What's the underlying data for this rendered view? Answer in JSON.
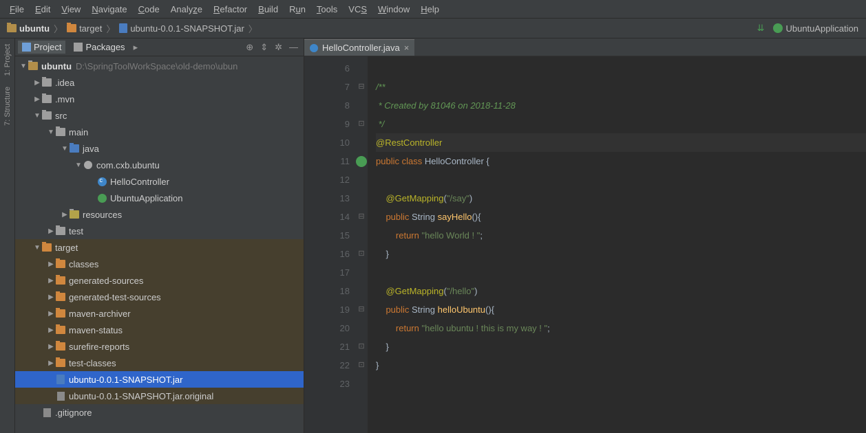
{
  "menu": [
    "File",
    "Edit",
    "View",
    "Navigate",
    "Code",
    "Analyze",
    "Refactor",
    "Build",
    "Run",
    "Tools",
    "VCS",
    "Window",
    "Help"
  ],
  "breadcrumb": {
    "items": [
      "ubuntu",
      "target",
      "ubuntu-0.0.1-SNAPSHOT.jar"
    ]
  },
  "runconfig": {
    "label": "UbuntuApplication"
  },
  "sidebar": {
    "tabs": {
      "project": "Project",
      "packages": "Packages"
    },
    "root": {
      "name": "ubuntu",
      "path": "D:\\SpringToolWorkSpace\\old-demo\\ubun"
    },
    "nodes": {
      "idea": ".idea",
      "mvn": ".mvn",
      "src": "src",
      "main": "main",
      "java": "java",
      "pkg": "com.cxb.ubuntu",
      "cls1": "HelloController",
      "cls2": "UbuntuApplication",
      "resources": "resources",
      "test": "test",
      "target": "target",
      "classes": "classes",
      "gensrc": "generated-sources",
      "gentest": "generated-test-sources",
      "mvnarch": "maven-archiver",
      "mvnstat": "maven-status",
      "sfire": "surefire-reports",
      "tcls": "test-classes",
      "jar": "ubuntu-0.0.1-SNAPSHOT.jar",
      "jarorig": "ubuntu-0.0.1-SNAPSHOT.jar.original",
      "gitign": ".gitignore"
    }
  },
  "vtools": {
    "project": "1: Project",
    "structure": "7: Structure"
  },
  "editor": {
    "tab": "HelloController.java",
    "gutter_start": 6,
    "gutter_end": 23,
    "code": {
      "l6": "",
      "l7_open": "/**",
      "l8": " * Created by 81046 on 2018-11-28",
      "l9": " */",
      "l10": "@RestController",
      "l11_pre": "public class ",
      "l11_cls": "HelloController",
      "l11_post": " {",
      "l12": "",
      "l13_anno": "@GetMapping",
      "l13_str": "\"/say\"",
      "l14_pre": "public ",
      "l14_type": "String ",
      "l14_m": "sayHello",
      "l14_post": "(){",
      "l15_kw": "return ",
      "l15_str": "\"hello World ! \"",
      "l16": "}",
      "l17": "",
      "l18_anno": "@GetMapping",
      "l18_str": "\"/hello\"",
      "l19_pre": "public ",
      "l19_type": "String ",
      "l19_m": "helloUbuntu",
      "l19_post": "(){",
      "l20_kw": "return ",
      "l20_str": "\"hello ubuntu ! this is my way ! \"",
      "l21": "}",
      "l22": "}",
      "l23": ""
    }
  }
}
